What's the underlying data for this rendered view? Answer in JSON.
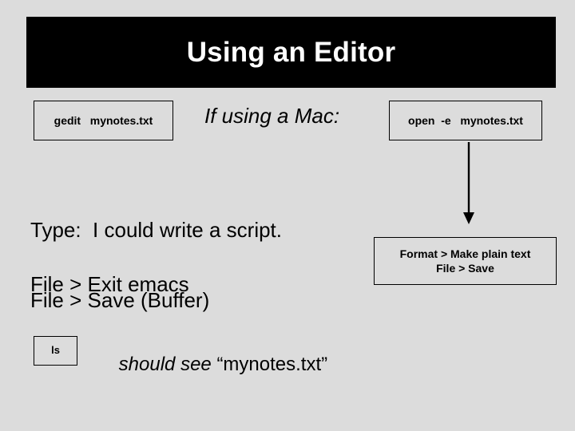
{
  "slide": {
    "title": "Using an Editor",
    "background_color": "#dcdcdc",
    "title_bar_color": "#000000",
    "title_text_color": "#ffffff"
  },
  "boxes": {
    "gedit": {
      "command": "gedit   mynotes.txt"
    },
    "open": {
      "command": "open  -e   mynotes.txt"
    },
    "format": {
      "line1": "Format > Make plain text",
      "line2": "File > Save"
    },
    "ls": {
      "command": "ls"
    }
  },
  "text": {
    "mac_note": "If using a Mac:",
    "type_line": "Type:  I could write a script.",
    "save_line": "File > Save (Buffer)",
    "exit_line": "File > Exit emacs",
    "should_see_prefix": "should see ",
    "should_see_filename": "“mynotes.txt”"
  },
  "arrow": {
    "name": "down-arrow",
    "direction": "down",
    "color": "#000000"
  }
}
